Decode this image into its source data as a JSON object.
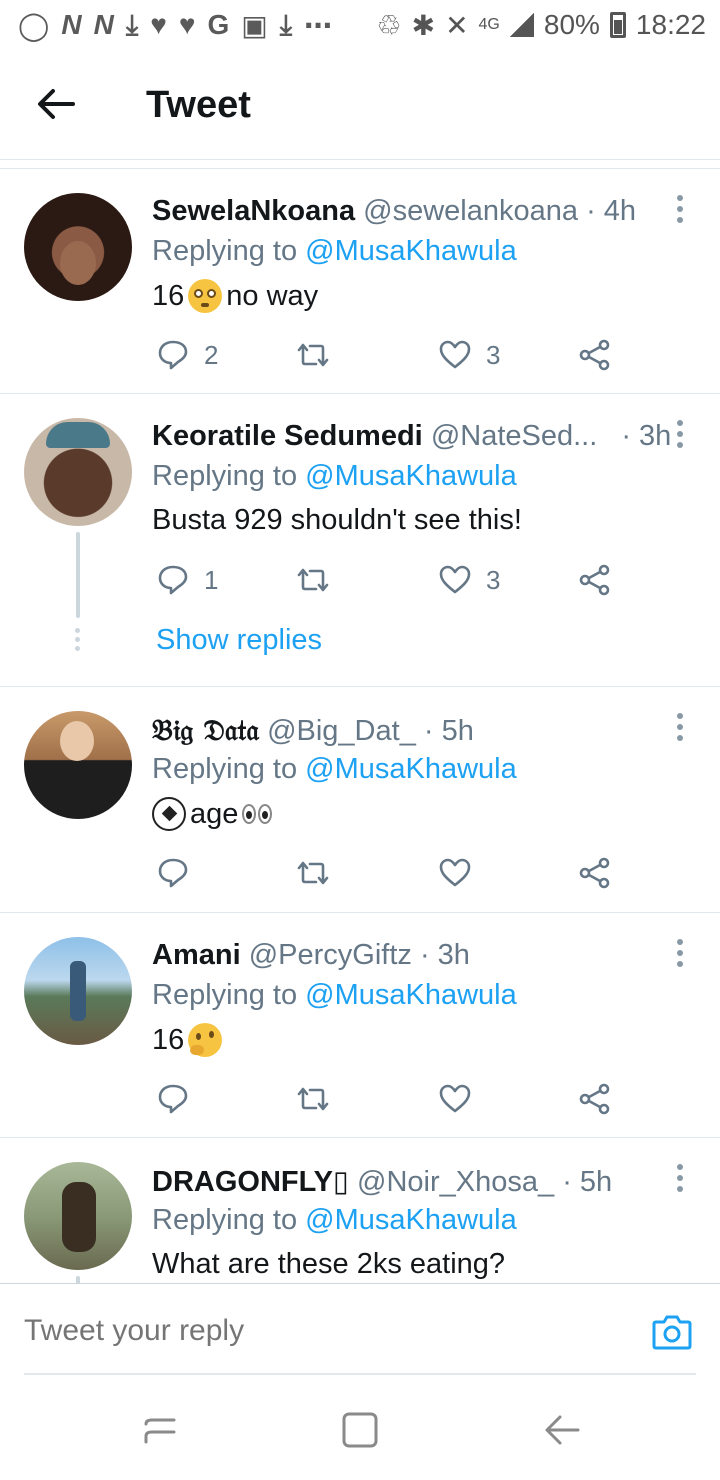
{
  "status_bar": {
    "left_icons": [
      "whatsapp-icon",
      "n-icon",
      "n-icon",
      "download-icon",
      "twitter-icon",
      "twitter-icon",
      "google-icon",
      "gallery-icon",
      "download-icon",
      "more-icon"
    ],
    "battery": "80%",
    "time": "18:22",
    "network": "4G"
  },
  "header": {
    "title": "Tweet"
  },
  "tweets": [
    {
      "name": "SewelaNkoana",
      "handle": "@sewelankoana",
      "time": "· 4h",
      "replying_label": "Replying to",
      "mention": "@MusaKhawula",
      "text_pre": "16",
      "emoji": "flushed-face",
      "text_post": "no way",
      "replies": "2",
      "retweets": "",
      "likes": "3"
    },
    {
      "name": "Keoratile Sedumedi",
      "handle": "@NateSed...",
      "time": "· 3h",
      "replying_label": "Replying to",
      "mention": "@MusaKhawula",
      "text": "Busta 929 shouldn't see this!",
      "replies": "1",
      "retweets": "",
      "likes": "3",
      "show_replies": "Show replies"
    },
    {
      "name": "𝔅𝔦𝔤 𝔇𝔞𝔱𝔞",
      "handle": "@Big_Dat_",
      "time": "· 5h",
      "replying_label": "Replying to",
      "mention": "@MusaKhawula",
      "emoji_pre": "soccer-ball",
      "text": "age",
      "emoji_post": "eyes",
      "replies": "",
      "retweets": "",
      "likes": ""
    },
    {
      "name": "Amani",
      "handle": "@PercyGiftz",
      "time": "· 3h",
      "replying_label": "Replying to",
      "mention": "@MusaKhawula",
      "text_pre": "16",
      "emoji": "thinking-face",
      "replies": "",
      "retweets": "",
      "likes": ""
    },
    {
      "name": "DRAGONFLY▯",
      "handle": "@Noir_Xhosa_",
      "time": "· 5h",
      "replying_label": "Replying to",
      "mention": "@MusaKhawula",
      "text": "What are these 2ks eating?"
    }
  ],
  "compose": {
    "placeholder": "Tweet your reply"
  },
  "colors": {
    "accent": "#1da1f2",
    "text": "#14171a",
    "muted": "#657786",
    "border": "#e1e8ed"
  }
}
